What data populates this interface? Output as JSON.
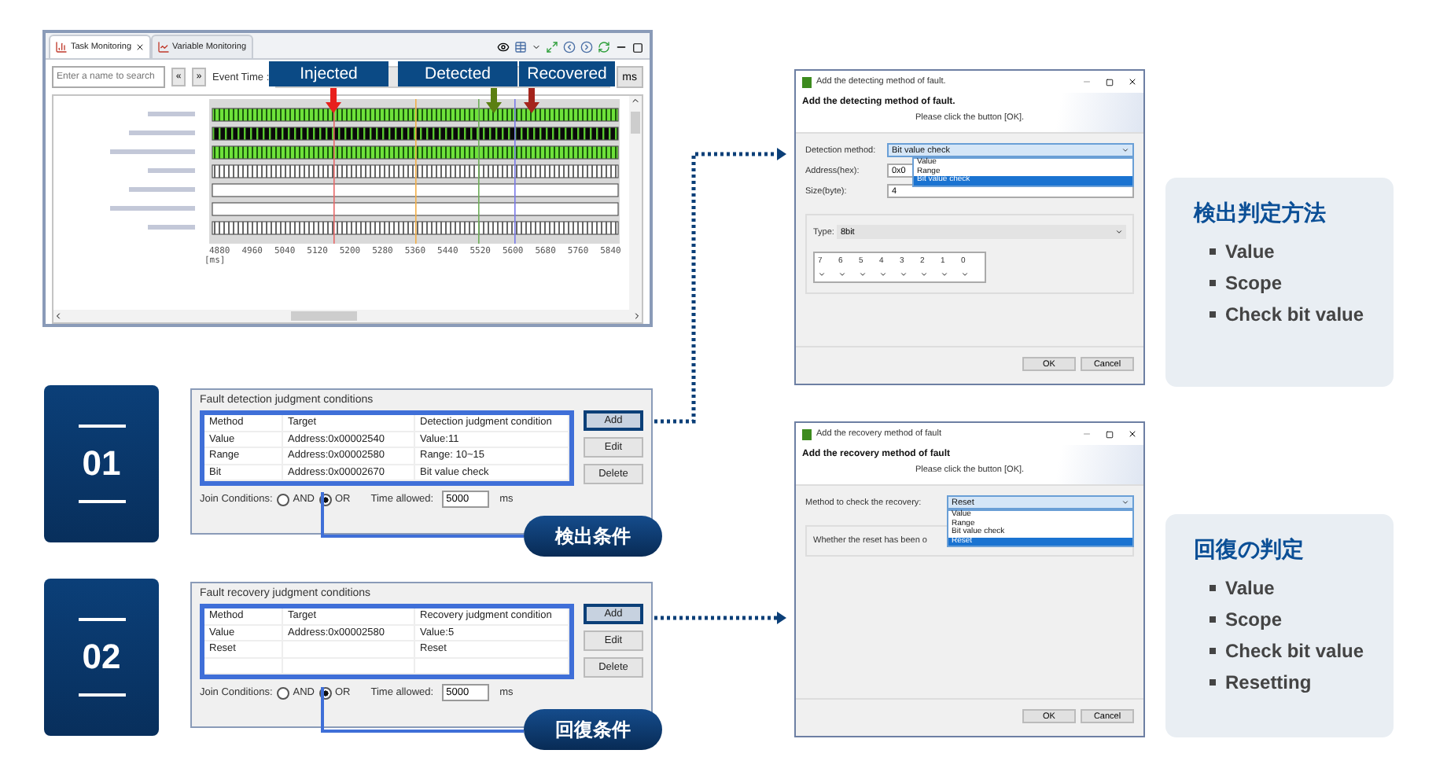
{
  "monitor": {
    "tabs": [
      {
        "label": "Task Monitoring",
        "selected": true
      },
      {
        "label": "Variable Monitoring",
        "selected": false
      }
    ],
    "search": {
      "placeholder": "Enter a name to search"
    },
    "nav_buttons": [
      "«",
      "»"
    ],
    "event_time_label": "Event Time :",
    "toolbar_button": "ms",
    "markers": [
      {
        "label": "Injected",
        "color": "#e8201c"
      },
      {
        "label": "Detected",
        "color": "#5b7f12"
      },
      {
        "label": "Recovered",
        "color": "#a4241c"
      }
    ],
    "rows": [
      {
        "kind": "green"
      },
      {
        "kind": "dark"
      },
      {
        "kind": "green"
      },
      {
        "kind": "striped"
      },
      {
        "kind": "blank"
      },
      {
        "kind": "blank"
      },
      {
        "kind": "striped"
      }
    ],
    "cursor_lines": [
      {
        "color": "#e86a6a"
      },
      {
        "color": "#f2b04a"
      },
      {
        "color": "#6fae5a"
      },
      {
        "color": "#7a7ae8"
      }
    ],
    "ticks": [
      "4880",
      "4960",
      "5040",
      "5120",
      "5200",
      "5280",
      "5360",
      "5440",
      "5520",
      "5600",
      "5680",
      "5760",
      "5840"
    ],
    "unit": "[ms]"
  },
  "steps": [
    {
      "number": "01",
      "title": "Fault detection judgment conditions",
      "columns": [
        "Method",
        "Target",
        "Detection judgment condition"
      ],
      "rows": [
        [
          "Value",
          "Address:0x00002540",
          "Value:11"
        ],
        [
          "Range",
          "Address:0x00002580",
          "Range: 10~15"
        ],
        [
          "Bit",
          "Address:0x00002670",
          "Bit value check"
        ]
      ],
      "buttons": [
        {
          "label": "Add",
          "highlighted": true
        },
        {
          "label": "Edit",
          "highlighted": false
        },
        {
          "label": "Delete",
          "highlighted": false
        }
      ],
      "join_label": "Join Conditions:",
      "options": [
        {
          "label": "AND",
          "selected": false
        },
        {
          "label": "OR",
          "selected": true
        }
      ],
      "time_label": "Time allowed:",
      "time_value": "5000",
      "time_unit": "ms",
      "callout": "検出条件"
    },
    {
      "number": "02",
      "title": "Fault recovery judgment conditions",
      "columns": [
        "Method",
        "Target",
        "Recovery judgment condition"
      ],
      "rows": [
        [
          "Value",
          "Address:0x00002580",
          "Value:5"
        ],
        [
          "Reset",
          null,
          "Reset"
        ],
        [
          null,
          null,
          null
        ]
      ],
      "buttons": [
        {
          "label": "Add",
          "highlighted": true
        },
        {
          "label": "Edit",
          "highlighted": false
        },
        {
          "label": "Delete",
          "highlighted": false
        }
      ],
      "join_label": "Join Conditions:",
      "options": [
        {
          "label": "AND",
          "selected": false
        },
        {
          "label": "OR",
          "selected": true
        }
      ],
      "time_label": "Time allowed:",
      "time_value": "5000",
      "time_unit": "ms",
      "callout": "回復条件"
    }
  ],
  "dialogs": [
    {
      "kind": "detect",
      "title": "Add the detecting method of fault.",
      "heading": "Add the detecting method of fault.",
      "hint": "Please click the button [OK].",
      "select_label": "Detection method:",
      "select_value": "Bit value check",
      "options": [
        {
          "label": "Value",
          "selected": false
        },
        {
          "label": "Range",
          "selected": false
        },
        {
          "label": "Bit value check",
          "selected": true
        }
      ],
      "fields": [
        {
          "label": "Address(hex):",
          "value": "0x0"
        },
        {
          "label": "Size(byte):",
          "value": "4"
        }
      ],
      "type_label": "Type:",
      "type_value": "8bit",
      "bits": [
        "7",
        "6",
        "5",
        "4",
        "3",
        "2",
        "1",
        "0"
      ],
      "buttons": [
        "OK",
        "Cancel"
      ]
    },
    {
      "kind": "recover",
      "title": "Add the recovery method of fault",
      "heading": "Add the recovery method of fault",
      "hint": "Please click the button [OK].",
      "select_label": "Method to check the recovery:",
      "select_value": "Reset",
      "options": [
        {
          "label": "Value",
          "selected": false
        },
        {
          "label": "Range",
          "selected": false
        },
        {
          "label": "Bit value check",
          "selected": false
        },
        {
          "label": "Reset",
          "selected": true
        }
      ],
      "group_text": "Whether the reset has been o",
      "buttons": [
        "OK",
        "Cancel"
      ]
    }
  ],
  "info_boxes": [
    {
      "title": "検出判定方法",
      "items": [
        "Value",
        "Scope",
        "Check bit value"
      ]
    },
    {
      "title": "回復の判定",
      "items": [
        "Value",
        "Scope",
        "Check bit value",
        "Resetting"
      ]
    }
  ]
}
